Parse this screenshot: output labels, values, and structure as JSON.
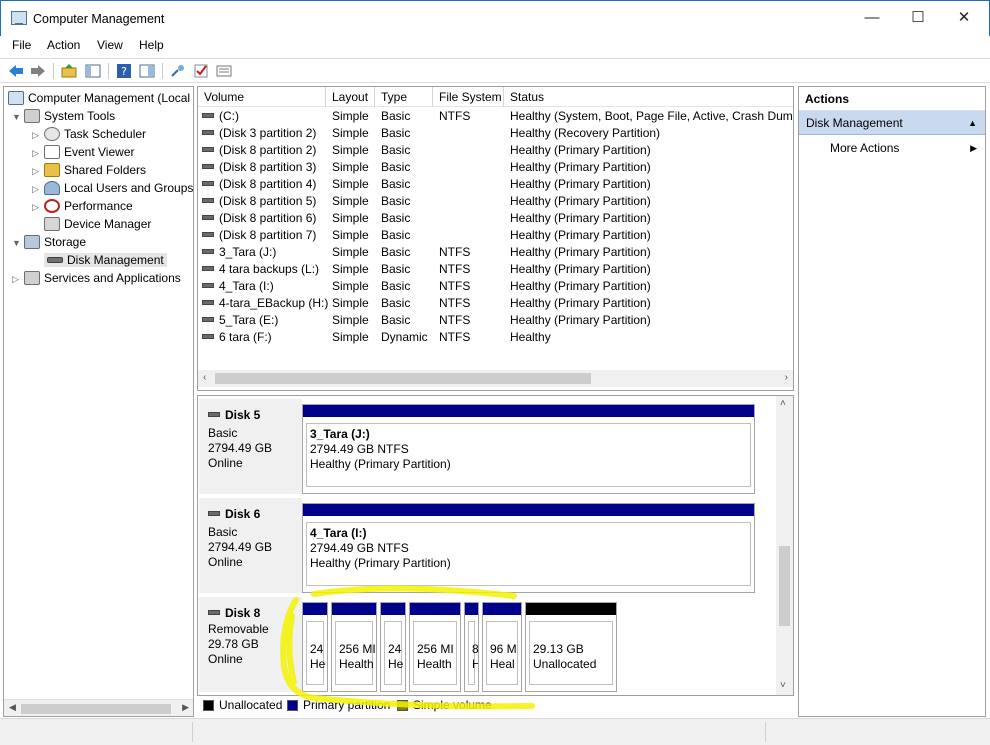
{
  "window": {
    "title": "Computer Management",
    "minimize": "—",
    "maximize": "☐",
    "close": "✕"
  },
  "menu": [
    "File",
    "Action",
    "View",
    "Help"
  ],
  "tree": {
    "root": "Computer Management (Local",
    "system_tools": "System Tools",
    "task_scheduler": "Task Scheduler",
    "event_viewer": "Event Viewer",
    "shared_folders": "Shared Folders",
    "local_users": "Local Users and Groups",
    "performance": "Performance",
    "device_manager": "Device Manager",
    "storage": "Storage",
    "disk_management": "Disk Management",
    "services": "Services and Applications"
  },
  "columns": {
    "volume": "Volume",
    "layout": "Layout",
    "type": "Type",
    "fs": "File System",
    "status": "Status"
  },
  "volumes": [
    {
      "name": "(C:)",
      "layout": "Simple",
      "type": "Basic",
      "fs": "NTFS",
      "status": "Healthy (System, Boot, Page File, Active, Crash Dump, P"
    },
    {
      "name": "(Disk 3 partition 2)",
      "layout": "Simple",
      "type": "Basic",
      "fs": "",
      "status": "Healthy (Recovery Partition)"
    },
    {
      "name": "(Disk 8 partition 2)",
      "layout": "Simple",
      "type": "Basic",
      "fs": "",
      "status": "Healthy (Primary Partition)"
    },
    {
      "name": "(Disk 8 partition 3)",
      "layout": "Simple",
      "type": "Basic",
      "fs": "",
      "status": "Healthy (Primary Partition)"
    },
    {
      "name": "(Disk 8 partition 4)",
      "layout": "Simple",
      "type": "Basic",
      "fs": "",
      "status": "Healthy (Primary Partition)"
    },
    {
      "name": "(Disk 8 partition 5)",
      "layout": "Simple",
      "type": "Basic",
      "fs": "",
      "status": "Healthy (Primary Partition)"
    },
    {
      "name": "(Disk 8 partition 6)",
      "layout": "Simple",
      "type": "Basic",
      "fs": "",
      "status": "Healthy (Primary Partition)"
    },
    {
      "name": "(Disk 8 partition 7)",
      "layout": "Simple",
      "type": "Basic",
      "fs": "",
      "status": "Healthy (Primary Partition)"
    },
    {
      "name": "3_Tara (J:)",
      "layout": "Simple",
      "type": "Basic",
      "fs": "NTFS",
      "status": "Healthy (Primary Partition)"
    },
    {
      "name": "4 tara backups (L:)",
      "layout": "Simple",
      "type": "Basic",
      "fs": "NTFS",
      "status": "Healthy (Primary Partition)"
    },
    {
      "name": "4_Tara (I:)",
      "layout": "Simple",
      "type": "Basic",
      "fs": "NTFS",
      "status": "Healthy (Primary Partition)"
    },
    {
      "name": "4-tara_EBackup (H:)",
      "layout": "Simple",
      "type": "Basic",
      "fs": "NTFS",
      "status": "Healthy (Primary Partition)"
    },
    {
      "name": "5_Tara (E:)",
      "layout": "Simple",
      "type": "Basic",
      "fs": "NTFS",
      "status": "Healthy (Primary Partition)"
    },
    {
      "name": "6 tara (F:)",
      "layout": "Simple",
      "type": "Dynamic",
      "fs": "NTFS",
      "status": "Healthy"
    }
  ],
  "disks": {
    "disk5": {
      "name": "Disk 5",
      "type": "Basic",
      "size": "2794.49 GB",
      "state": "Online",
      "part": {
        "label": "3_Tara  (J:)",
        "size": "2794.49 GB NTFS",
        "status": "Healthy (Primary Partition)"
      }
    },
    "disk6": {
      "name": "Disk 6",
      "type": "Basic",
      "size": "2794.49 GB",
      "state": "Online",
      "part": {
        "label": "4_Tara  (I:)",
        "size": "2794.49 GB NTFS",
        "status": "Healthy (Primary Partition)"
      }
    },
    "disk8": {
      "name": "Disk 8",
      "type": "Removable",
      "size": "29.78 GB",
      "state": "Online",
      "parts": [
        {
          "size": "24",
          "status": "He"
        },
        {
          "size": "256 MI",
          "status": "Health"
        },
        {
          "size": "24",
          "status": "He"
        },
        {
          "size": "256 MI",
          "status": "Health"
        },
        {
          "size": "8",
          "status": "H"
        },
        {
          "size": "96 M",
          "status": "Heal"
        },
        {
          "size": "29.13 GB",
          "status": "Unallocated"
        }
      ]
    }
  },
  "legend": {
    "unallocated": "Unallocated",
    "primary": "Primary partition",
    "simple": "Simple volume"
  },
  "colors": {
    "unallocated": "#000000",
    "primary": "#00008b",
    "simple": "#808000",
    "highlight": "#f2f200"
  },
  "actions": {
    "header": "Actions",
    "section": "Disk Management",
    "more": "More Actions"
  }
}
